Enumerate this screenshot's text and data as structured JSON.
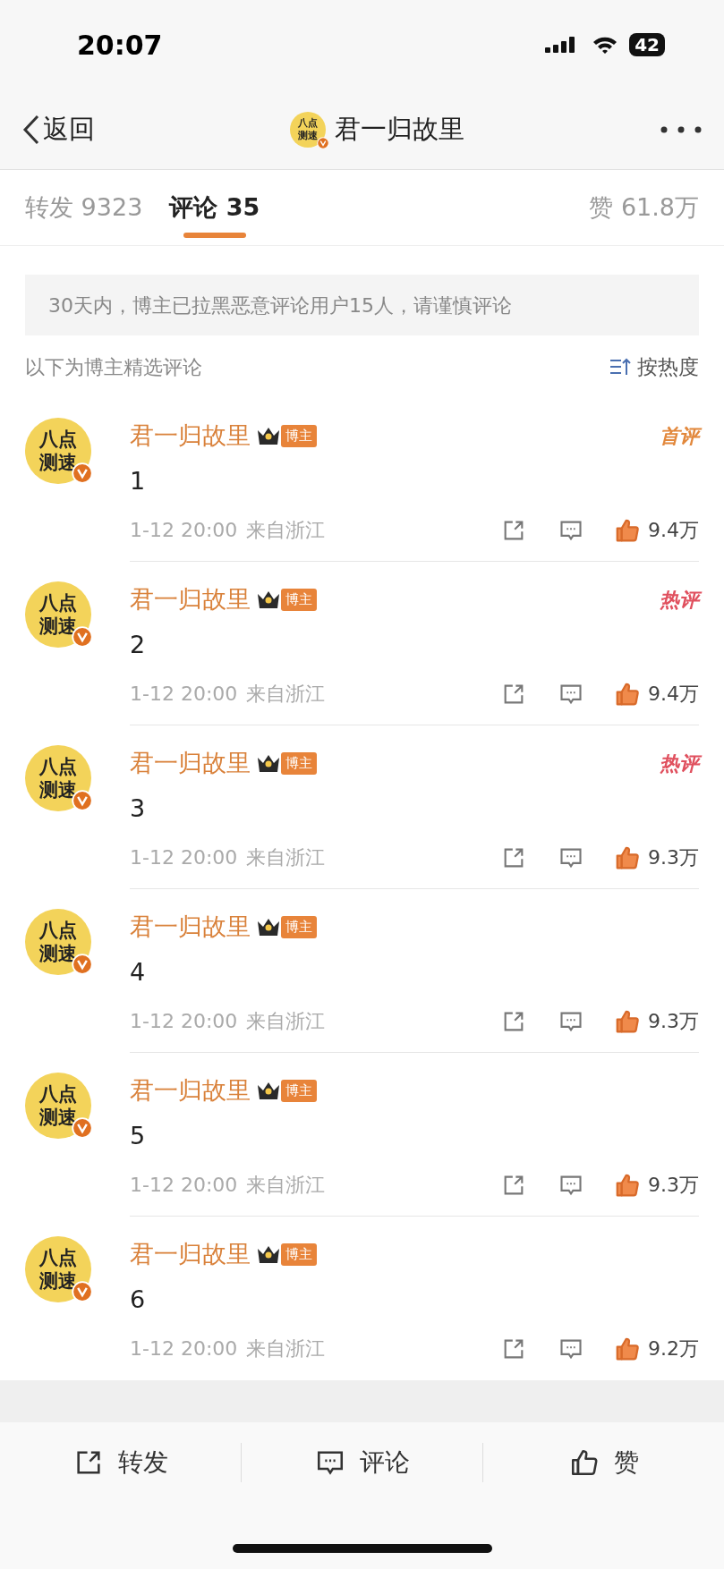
{
  "status_bar": {
    "time": "20:07",
    "battery": "42"
  },
  "nav": {
    "back": "返回",
    "avatar_lines": [
      "八点",
      "测速"
    ],
    "title": "君一归故里"
  },
  "tabs": [
    {
      "label": "转发",
      "count": "9323",
      "selected": false
    },
    {
      "label": "评论",
      "count": "35",
      "selected": true
    }
  ],
  "likes_tab": {
    "label": "赞",
    "count": "61.8万"
  },
  "notice": "30天内，博主已拉黑恶意评论用户15人，请谨慎评论",
  "section_label": "以下为博主精选评论",
  "sort": "按热度",
  "comments": [
    {
      "avatar_lines": [
        "八点",
        "测速"
      ],
      "author": "君一归故里",
      "badge": "博主",
      "tag": {
        "kind": "first",
        "label": "首评"
      },
      "text": "1",
      "time": "1-12 20:00",
      "location": "来自浙江",
      "likes": "9.4万"
    },
    {
      "avatar_lines": [
        "八点",
        "测速"
      ],
      "author": "君一归故里",
      "badge": "博主",
      "tag": {
        "kind": "hot",
        "label": "热评"
      },
      "text": "2",
      "time": "1-12 20:00",
      "location": "来自浙江",
      "likes": "9.4万"
    },
    {
      "avatar_lines": [
        "八点",
        "测速"
      ],
      "author": "君一归故里",
      "badge": "博主",
      "tag": {
        "kind": "hot",
        "label": "热评"
      },
      "text": "3",
      "time": "1-12 20:00",
      "location": "来自浙江",
      "likes": "9.3万"
    },
    {
      "avatar_lines": [
        "八点",
        "测速"
      ],
      "author": "君一归故里",
      "badge": "博主",
      "text": "4",
      "time": "1-12 20:00",
      "location": "来自浙江",
      "likes": "9.3万"
    },
    {
      "avatar_lines": [
        "八点",
        "测速"
      ],
      "author": "君一归故里",
      "badge": "博主",
      "text": "5",
      "time": "1-12 20:00",
      "location": "来自浙江",
      "likes": "9.3万"
    },
    {
      "avatar_lines": [
        "八点",
        "测速"
      ],
      "author": "君一归故里",
      "badge": "博主",
      "text": "6",
      "time": "1-12 20:00",
      "location": "来自浙江",
      "likes": "9.2万"
    }
  ],
  "bottom_actions": [
    {
      "kind": "repost",
      "label": "转发"
    },
    {
      "kind": "comment",
      "label": "评论"
    },
    {
      "kind": "like",
      "label": "赞"
    }
  ]
}
